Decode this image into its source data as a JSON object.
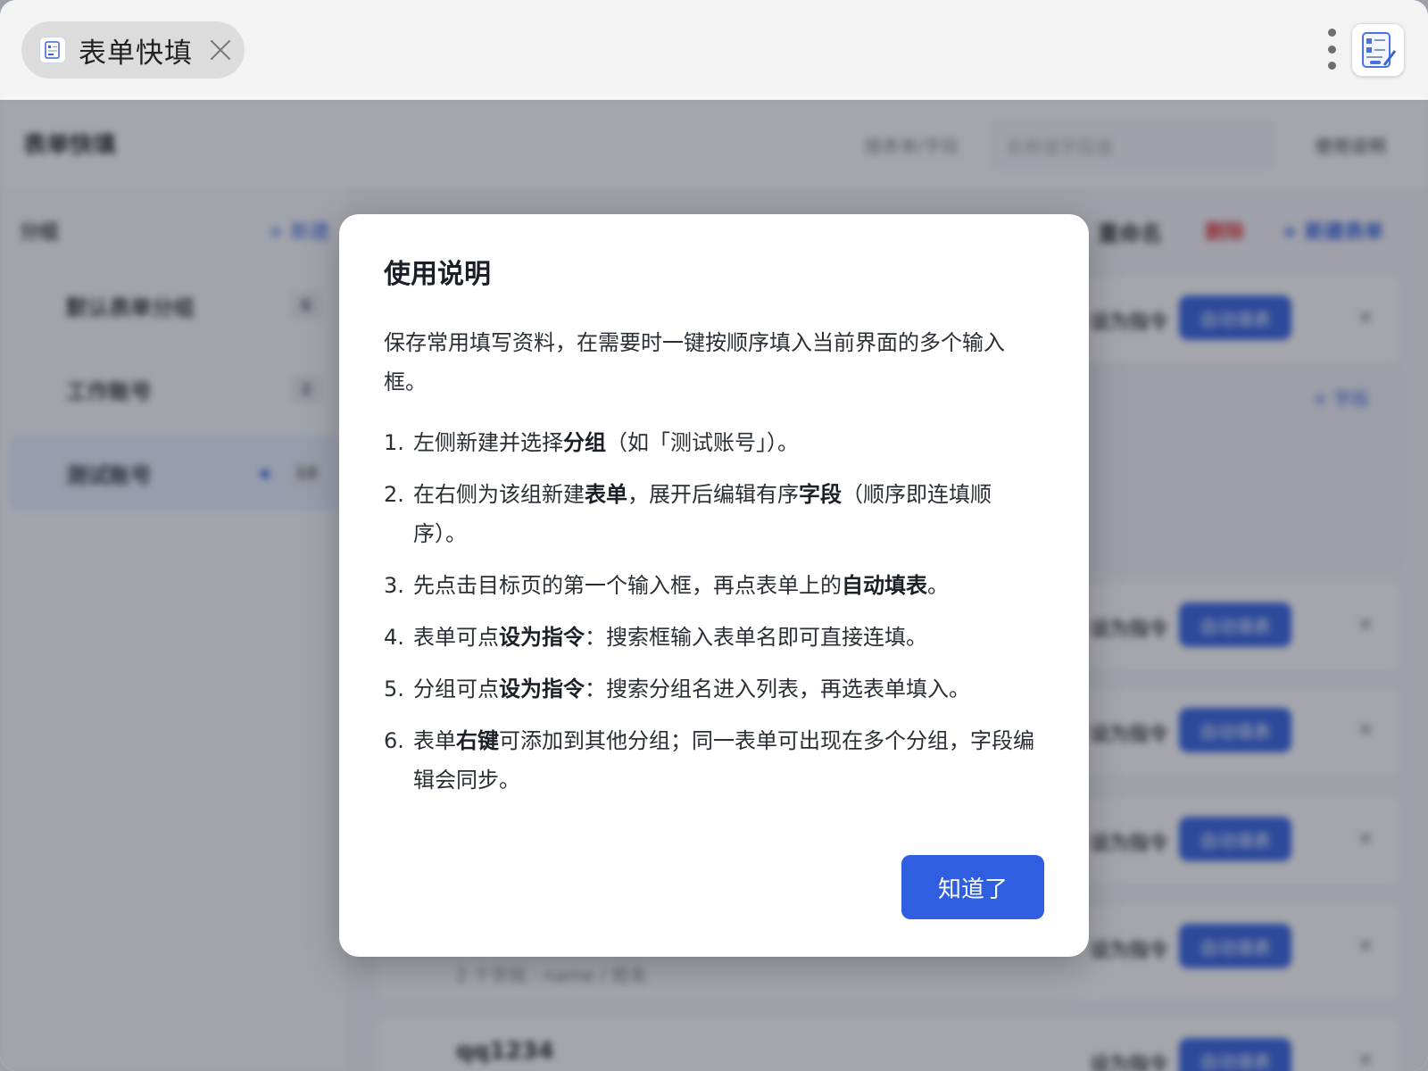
{
  "chrome": {
    "tab_title": "表单快填"
  },
  "app": {
    "title": "表单快填",
    "search_label": "搜表单/字段",
    "search_placeholder": "名称或字段值",
    "help_button": "使用说明",
    "sidebar": {
      "heading": "分组",
      "new_label": "+ 新建",
      "groups": [
        {
          "label": "默认表单分组",
          "count": "6"
        },
        {
          "label": "工作账号",
          "count": "2"
        },
        {
          "label": "测试账号",
          "count": "10"
        }
      ]
    },
    "toolbar": {
      "rename": "重命名",
      "delete": "删除",
      "new_form": "+ 新建表单"
    },
    "forms": [
      {
        "name": "",
        "meta": "",
        "cmd": "设为指令",
        "auto": "自动填表"
      },
      {
        "name": "",
        "meta": "",
        "cmd": "设为指令",
        "auto": "自动填表"
      },
      {
        "name": "",
        "meta": "",
        "cmd": "设为指令",
        "auto": "自动填表"
      },
      {
        "name": "",
        "meta": "",
        "cmd": "设为指令",
        "auto": "自动填表"
      },
      {
        "name": "",
        "meta": "2 个字段 · name / 姓名",
        "cmd": "设为指令",
        "auto": "自动填表"
      },
      {
        "name": "qq1234",
        "meta": "",
        "cmd": "设为指令",
        "auto": "自动填表"
      }
    ],
    "add_field": "+ 字段"
  },
  "modal": {
    "title": "使用说明",
    "intro": "保存常用填写资料，在需要时一键按顺序填入当前界面的多个输入框。",
    "steps": [
      {
        "num": "1.",
        "parts": [
          "左侧新建并选择",
          "分组",
          "（如「测试账号」）。"
        ]
      },
      {
        "num": "2.",
        "parts": [
          "在右侧为该组新建",
          "表单",
          "，展开后编辑有序",
          "字段",
          "（顺序即连填顺序）。"
        ]
      },
      {
        "num": "3.",
        "parts": [
          "先点击目标页的第一个输入框，再点表单上的",
          "自动填表",
          "。"
        ]
      },
      {
        "num": "4.",
        "parts": [
          "表单可点",
          "设为指令",
          "：搜索框输入表单名即可直接连填。"
        ]
      },
      {
        "num": "5.",
        "parts": [
          "分组可点",
          "设为指令",
          "：搜索分组名进入列表，再选表单填入。"
        ]
      },
      {
        "num": "6.",
        "parts": [
          "表单",
          "右键",
          "可添加到其他分组；同一表单可出现在多个分组，字段编辑会同步。"
        ]
      }
    ],
    "ok_button": "知道了"
  },
  "colors": {
    "accent": "#2f5fe0",
    "overlay": "#282c3c",
    "danger": "#dd3333"
  },
  "icons": {
    "tab": "form-doc-icon",
    "close": "close-icon",
    "menu": "more-vertical-icon",
    "app": "form-doc-icon"
  }
}
